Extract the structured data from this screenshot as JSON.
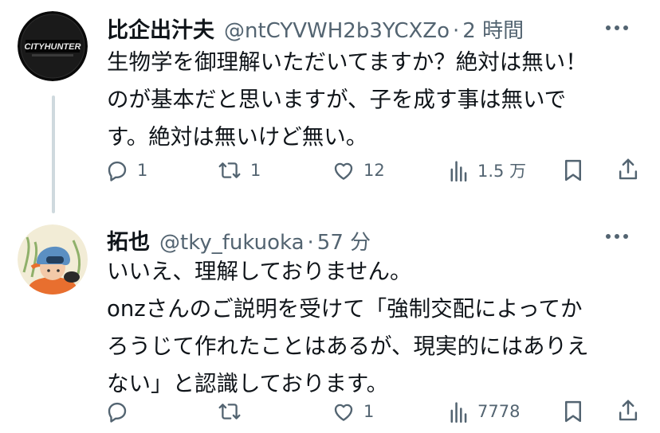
{
  "tweets": [
    {
      "author_name": "比企出汁夫",
      "handle": "@ntCYVWH2b3YCXZo",
      "separator": "·",
      "time": "2 時間",
      "body": "生物学を御理解いただいてますか？絶対は無い！\nのが基本だと思いますが、子を成す事は無いで\nす。絶対は無いけど無い。",
      "avatar_logo_text": "CITYHUNTER",
      "actions": {
        "reply_count": "1",
        "repost_count": "1",
        "like_count": "12",
        "views_count": "1.5 万"
      }
    },
    {
      "author_name": "拓也",
      "handle": "@tky_fukuoka",
      "separator": "·",
      "time": "57 分",
      "body": "いいえ、理解しておりません。\nonzさんのご説明を受けて「強制交配によってか\nろうじて作れたことはあるが、現実的にはありえ\nない」と認識しております。",
      "actions": {
        "reply_count": "",
        "repost_count": "",
        "like_count": "1",
        "views_count": "7778"
      }
    }
  ],
  "colors": {
    "text": "#0f1419",
    "secondary": "#536471",
    "thread_line": "#cfd9de"
  },
  "icons": [
    "reply-icon",
    "repost-icon",
    "like-icon",
    "views-icon",
    "bookmark-icon",
    "share-icon",
    "more-icon"
  ]
}
